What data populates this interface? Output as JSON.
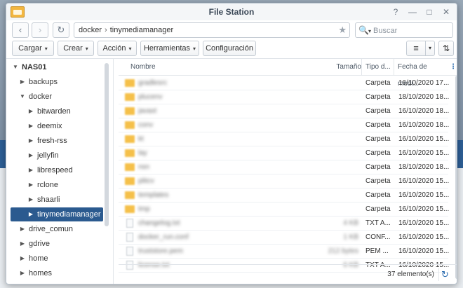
{
  "window": {
    "title": "File Station",
    "controls": {
      "help": "?",
      "minimize": "—",
      "maximize": "□",
      "close": "✕"
    }
  },
  "navbar": {
    "back": "‹",
    "forward": "›",
    "refresh": "↻",
    "path": [
      "docker",
      "tinymediamanager"
    ],
    "path_separator": "›",
    "star": "★",
    "search_placeholder": "Buscar",
    "search_icon": "🔍",
    "search_caret": "▾"
  },
  "toolbar": {
    "upload": "Cargar",
    "create": "Crear",
    "action": "Acción",
    "tools": "Herramientas",
    "settings": "Configuración",
    "caret": "▾",
    "view_icon": "≡",
    "view_caret": "▾",
    "sort_icon": "⇅"
  },
  "sidebar": {
    "items": [
      {
        "label": "NAS01",
        "arrow": "▼",
        "level": 0,
        "bold": true
      },
      {
        "label": "backups",
        "arrow": "▶",
        "level": 1
      },
      {
        "label": "docker",
        "arrow": "▼",
        "level": 1
      },
      {
        "label": "bitwarden",
        "arrow": "▶",
        "level": 2
      },
      {
        "label": "deemix",
        "arrow": "▶",
        "level": 2
      },
      {
        "label": "fresh-rss",
        "arrow": "▶",
        "level": 2
      },
      {
        "label": "jellyfin",
        "arrow": "▶",
        "level": 2
      },
      {
        "label": "librespeed",
        "arrow": "▶",
        "level": 2
      },
      {
        "label": "rclone",
        "arrow": "▶",
        "level": 2
      },
      {
        "label": "shaarli",
        "arrow": "▶",
        "level": 2
      },
      {
        "label": "tinymediamanager",
        "arrow": "▶",
        "level": 2,
        "selected": true
      },
      {
        "label": "drive_comun",
        "arrow": "▶",
        "level": 1
      },
      {
        "label": "gdrive",
        "arrow": "▶",
        "level": 1
      },
      {
        "label": "home",
        "arrow": "▶",
        "level": 1
      },
      {
        "label": "homes",
        "arrow": "▶",
        "level": 1
      }
    ]
  },
  "table": {
    "headers": {
      "name": "Nombre",
      "size": "Tamaño",
      "type": "Tipo d...",
      "date": "Fecha de modi...",
      "menu": "⋮"
    },
    "rows": [
      {
        "icon": "folder-icon",
        "name": "gradlesrc",
        "size": "",
        "type": "Carpeta",
        "date": "16/10/2020 17..."
      },
      {
        "icon": "folder-icon",
        "name": "plucenv",
        "size": "",
        "type": "Carpeta",
        "date": "18/10/2020 18..."
      },
      {
        "icon": "folder-icon",
        "name": "javaxt",
        "size": "",
        "type": "Carpeta",
        "date": "16/10/2020 18..."
      },
      {
        "icon": "folder-icon",
        "name": "conv",
        "size": "",
        "type": "Carpeta",
        "date": "16/10/2020 18..."
      },
      {
        "icon": "folder-icon",
        "name": "kt",
        "size": "",
        "type": "Carpeta",
        "date": "16/10/2020 15..."
      },
      {
        "icon": "folder-icon",
        "name": "lay",
        "size": "",
        "type": "Carpeta",
        "date": "16/10/2020 15..."
      },
      {
        "icon": "folder-icon",
        "name": "nsn",
        "size": "",
        "type": "Carpeta",
        "date": "18/10/2020 18..."
      },
      {
        "icon": "folder-icon",
        "name": "plitcv",
        "size": "",
        "type": "Carpeta",
        "date": "16/10/2020 15..."
      },
      {
        "icon": "folder-icon",
        "name": "templates",
        "size": "",
        "type": "Carpeta",
        "date": "16/10/2020 15..."
      },
      {
        "icon": "folder-icon",
        "name": "tmp",
        "size": "",
        "type": "Carpeta",
        "date": "16/10/2020 15..."
      },
      {
        "icon": "file-icon",
        "name": "changelog.txt",
        "size": "4 KB",
        "type": "TXT A...",
        "date": "16/10/2020 15..."
      },
      {
        "icon": "file-icon",
        "name": "docker_run.conf",
        "size": "1 KB",
        "type": "CONF...",
        "date": "16/10/2020 15..."
      },
      {
        "icon": "file-icon",
        "name": "truststore.pem",
        "size": "212 bytes",
        "type": "PEM ...",
        "date": "16/10/2020 15..."
      },
      {
        "icon": "file-icon",
        "name": "license.txt",
        "size": "6 KB",
        "type": "TXT A...",
        "date": "16/10/2020 15..."
      }
    ]
  },
  "status": {
    "count": "37 elemento(s)",
    "refresh": "↻"
  }
}
